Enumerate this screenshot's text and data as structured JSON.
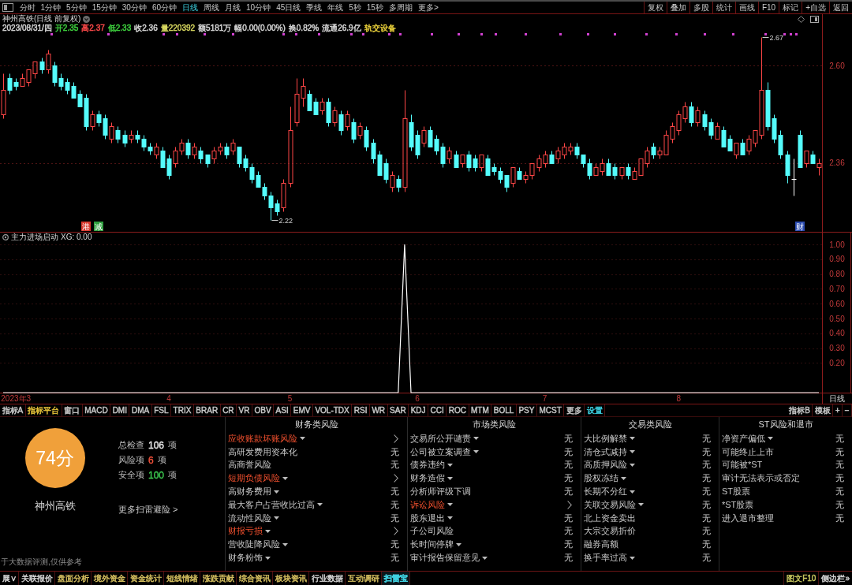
{
  "toolbar": {
    "periods": [
      {
        "label": "分时",
        "selected": false
      },
      {
        "label": "1分钟",
        "selected": false
      },
      {
        "label": "5分钟",
        "selected": false
      },
      {
        "label": "15分钟",
        "selected": false
      },
      {
        "label": "30分钟",
        "selected": false
      },
      {
        "label": "60分钟",
        "selected": false
      },
      {
        "label": "日线",
        "selected": true
      },
      {
        "label": "周线",
        "selected": false
      },
      {
        "label": "月线",
        "selected": false
      },
      {
        "label": "10分钟",
        "selected": false
      },
      {
        "label": "45日线",
        "selected": false
      },
      {
        "label": "季线",
        "selected": false
      },
      {
        "label": "年线",
        "selected": false
      },
      {
        "label": "5秒",
        "selected": false
      },
      {
        "label": "15秒",
        "selected": false
      },
      {
        "label": "多周期",
        "selected": false
      },
      {
        "label": "更多>",
        "selected": false
      }
    ],
    "actions": [
      "复权",
      "叠加",
      "多股",
      "统计",
      "画线",
      "F10",
      "标记",
      "+自选",
      "返回"
    ]
  },
  "stock": {
    "title": "神州高铁(日线 前复权)",
    "quote": [
      {
        "text": "2023/08/31/四",
        "color": "#d8d8d8"
      },
      {
        "text": "开2.35",
        "color": "#3fd43f"
      },
      {
        "text": "高2.37",
        "color": "#ff4a4a"
      },
      {
        "text": "低2.33",
        "color": "#3fd43f"
      },
      {
        "text": "收2.36",
        "color": "#d8d8d8"
      },
      {
        "text": "量220392",
        "color": "#d8d860"
      },
      {
        "text": "额5181万",
        "color": "#d8d8d8"
      },
      {
        "text": "幅0.00(0.00%)",
        "color": "#d8d8d8"
      },
      {
        "text": "换0.82%",
        "color": "#d8d8d8"
      },
      {
        "text": "流通26.9亿",
        "color": "#d8d8d8"
      },
      {
        "text": "轨交设备",
        "color": "#e8cf3a"
      }
    ]
  },
  "price_chart": {
    "event_tags": [
      {
        "label": "港",
        "color": "#d9362b"
      },
      {
        "label": "减",
        "color": "#2e9e3e"
      },
      {
        "label": "财",
        "color": "#2a4bb0"
      }
    ],
    "chart_data": [
      {
        "type": "candlestick",
        "ylim": [
          2.19,
          2.68
        ],
        "yticks": [
          {
            "value": 2.6,
            "label": "2.60"
          },
          {
            "value": 2.36,
            "label": "2.36"
          }
        ],
        "tick_labels": "y",
        "grid": true,
        "annotations": [
          "2.67",
          "2.22"
        ],
        "ohlc": [
          [
            2.48,
            2.58,
            2.47,
            2.54
          ],
          [
            2.57,
            2.58,
            2.53,
            2.54
          ],
          [
            2.56,
            2.57,
            2.54,
            2.55
          ],
          [
            2.55,
            2.58,
            2.55,
            2.57
          ],
          [
            2.56,
            2.59,
            2.55,
            2.59
          ],
          [
            2.58,
            2.61,
            2.57,
            2.61
          ],
          [
            2.61,
            2.62,
            2.58,
            2.59
          ],
          [
            2.59,
            2.64,
            2.58,
            2.63
          ],
          [
            2.6,
            2.61,
            2.55,
            2.56
          ],
          [
            2.57,
            2.58,
            2.54,
            2.55
          ],
          [
            2.56,
            2.57,
            2.53,
            2.54
          ],
          [
            2.55,
            2.56,
            2.52,
            2.52
          ],
          [
            2.53,
            2.54,
            2.5,
            2.5
          ],
          [
            2.52,
            2.53,
            2.44,
            2.45
          ],
          [
            2.45,
            2.49,
            2.44,
            2.48
          ],
          [
            2.48,
            2.49,
            2.45,
            2.46
          ],
          [
            2.47,
            2.48,
            2.42,
            2.43
          ],
          [
            2.42,
            2.46,
            2.41,
            2.45
          ],
          [
            2.44,
            2.45,
            2.41,
            2.42
          ],
          [
            2.43,
            2.44,
            2.4,
            2.41
          ],
          [
            2.42,
            2.44,
            2.41,
            2.43
          ],
          [
            2.43,
            2.44,
            2.41,
            2.42
          ],
          [
            2.42,
            2.43,
            2.39,
            2.4
          ],
          [
            2.4,
            2.41,
            2.38,
            2.39
          ],
          [
            2.38,
            2.41,
            2.37,
            2.4
          ],
          [
            2.39,
            2.4,
            2.35,
            2.35
          ],
          [
            2.37,
            2.38,
            2.32,
            2.33
          ],
          [
            2.36,
            2.4,
            2.35,
            2.39
          ],
          [
            2.39,
            2.42,
            2.38,
            2.41
          ],
          [
            2.41,
            2.42,
            2.37,
            2.38
          ],
          [
            2.38,
            2.41,
            2.37,
            2.4
          ],
          [
            2.39,
            2.4,
            2.36,
            2.37
          ],
          [
            2.38,
            2.38,
            2.35,
            2.36
          ],
          [
            2.37,
            2.4,
            2.36,
            2.39
          ],
          [
            2.39,
            2.41,
            2.38,
            2.4
          ],
          [
            2.4,
            2.41,
            2.37,
            2.38
          ],
          [
            2.39,
            2.42,
            2.38,
            2.41
          ],
          [
            2.4,
            2.4,
            2.35,
            2.36
          ],
          [
            2.37,
            2.38,
            2.34,
            2.35
          ],
          [
            2.35,
            2.36,
            2.31,
            2.32
          ],
          [
            2.33,
            2.34,
            2.3,
            2.3
          ],
          [
            2.3,
            2.31,
            2.27,
            2.28
          ],
          [
            2.28,
            2.29,
            2.22,
            2.25
          ],
          [
            2.26,
            2.27,
            2.23,
            2.24
          ],
          [
            2.25,
            2.32,
            2.24,
            2.31
          ],
          [
            2.31,
            2.5,
            2.3,
            2.44
          ],
          [
            2.46,
            2.57,
            2.45,
            2.53
          ],
          [
            2.52,
            2.57,
            2.5,
            2.55
          ],
          [
            2.53,
            2.54,
            2.49,
            2.49
          ],
          [
            2.51,
            2.52,
            2.48,
            2.48
          ],
          [
            2.49,
            2.52,
            2.48,
            2.51
          ],
          [
            2.51,
            2.52,
            2.45,
            2.46
          ],
          [
            2.46,
            2.5,
            2.45,
            2.49
          ],
          [
            2.48,
            2.49,
            2.43,
            2.44
          ],
          [
            2.45,
            2.49,
            2.44,
            2.48
          ],
          [
            2.46,
            2.47,
            2.41,
            2.42
          ],
          [
            2.43,
            2.46,
            2.42,
            2.45
          ],
          [
            2.44,
            2.45,
            2.39,
            2.4
          ],
          [
            2.41,
            2.42,
            2.36,
            2.37
          ],
          [
            2.38,
            2.39,
            2.33,
            2.33
          ],
          [
            2.36,
            2.37,
            2.31,
            2.32
          ],
          [
            2.3,
            2.34,
            2.29,
            2.33
          ],
          [
            2.32,
            2.33,
            2.29,
            2.3
          ],
          [
            2.3,
            2.54,
            2.29,
            2.47
          ],
          [
            2.46,
            2.48,
            2.39,
            2.4
          ],
          [
            2.43,
            2.44,
            2.37,
            2.38
          ],
          [
            2.41,
            2.45,
            2.4,
            2.44
          ],
          [
            2.44,
            2.45,
            2.4,
            2.4
          ],
          [
            2.42,
            2.43,
            2.38,
            2.39
          ],
          [
            2.4,
            2.41,
            2.35,
            2.36
          ],
          [
            2.37,
            2.4,
            2.36,
            2.39
          ],
          [
            2.38,
            2.39,
            2.35,
            2.35
          ],
          [
            2.36,
            2.38,
            2.35,
            2.38
          ],
          [
            2.38,
            2.39,
            2.34,
            2.35
          ],
          [
            2.37,
            2.38,
            2.34,
            2.35
          ],
          [
            2.35,
            2.38,
            2.34,
            2.38
          ],
          [
            2.37,
            2.38,
            2.33,
            2.33
          ],
          [
            2.35,
            2.36,
            2.33,
            2.34
          ],
          [
            2.34,
            2.35,
            2.31,
            2.32
          ],
          [
            2.33,
            2.33,
            2.29,
            2.3
          ],
          [
            2.31,
            2.35,
            2.3,
            2.35
          ],
          [
            2.34,
            2.35,
            2.32,
            2.32
          ],
          [
            2.32,
            2.34,
            2.31,
            2.33
          ],
          [
            2.33,
            2.36,
            2.32,
            2.36
          ],
          [
            2.35,
            2.38,
            2.34,
            2.37
          ],
          [
            2.36,
            2.39,
            2.35,
            2.38
          ],
          [
            2.38,
            2.39,
            2.36,
            2.36
          ],
          [
            2.37,
            2.4,
            2.36,
            2.39
          ],
          [
            2.38,
            2.41,
            2.37,
            2.4
          ],
          [
            2.39,
            2.41,
            2.38,
            2.4
          ],
          [
            2.4,
            2.41,
            2.37,
            2.38
          ],
          [
            2.38,
            2.38,
            2.35,
            2.36
          ],
          [
            2.36,
            2.37,
            2.32,
            2.33
          ],
          [
            2.33,
            2.36,
            2.33,
            2.35
          ],
          [
            2.34,
            2.37,
            2.33,
            2.36
          ],
          [
            2.36,
            2.37,
            2.33,
            2.33
          ],
          [
            2.35,
            2.36,
            2.32,
            2.33
          ],
          [
            2.33,
            2.35,
            2.32,
            2.35
          ],
          [
            2.35,
            2.36,
            2.32,
            2.33
          ],
          [
            2.32,
            2.35,
            2.32,
            2.34
          ],
          [
            2.33,
            2.37,
            2.33,
            2.37
          ],
          [
            2.36,
            2.4,
            2.35,
            2.39
          ],
          [
            2.4,
            2.41,
            2.37,
            2.38
          ],
          [
            2.38,
            2.4,
            2.37,
            2.39
          ],
          [
            2.38,
            2.44,
            2.38,
            2.43
          ],
          [
            2.42,
            2.46,
            2.41,
            2.45
          ],
          [
            2.44,
            2.49,
            2.43,
            2.48
          ],
          [
            2.47,
            2.51,
            2.46,
            2.5
          ],
          [
            2.5,
            2.51,
            2.45,
            2.46
          ],
          [
            2.46,
            2.5,
            2.45,
            2.49
          ],
          [
            2.48,
            2.49,
            2.44,
            2.45
          ],
          [
            2.46,
            2.47,
            2.42,
            2.43
          ],
          [
            2.42,
            2.46,
            2.42,
            2.45
          ],
          [
            2.44,
            2.45,
            2.4,
            2.4
          ],
          [
            2.42,
            2.43,
            2.39,
            2.39
          ],
          [
            2.38,
            2.41,
            2.37,
            2.41
          ],
          [
            2.41,
            2.42,
            2.38,
            2.38
          ],
          [
            2.39,
            2.43,
            2.38,
            2.42
          ],
          [
            2.41,
            2.44,
            2.4,
            2.44
          ],
          [
            2.43,
            2.67,
            2.42,
            2.54
          ],
          [
            2.54,
            2.56,
            2.44,
            2.45
          ],
          [
            2.47,
            2.48,
            2.41,
            2.42
          ],
          [
            2.43,
            2.44,
            2.37,
            2.38
          ],
          [
            2.38,
            2.39,
            2.31,
            2.33
          ],
          [
            2.32,
            2.37,
            2.28,
            2.32
          ],
          [
            2.43,
            2.44,
            2.35,
            2.35
          ],
          [
            2.36,
            2.39,
            2.35,
            2.39
          ],
          [
            2.38,
            2.39,
            2.36,
            2.36
          ],
          [
            2.35,
            2.37,
            2.33,
            2.36
          ]
        ]
      }
    ]
  },
  "indicator": {
    "reading": "XG: 0.00",
    "period": "日线",
    "chart_data": [
      {
        "type": "line",
        "title": "主力进场启动",
        "color": "#ffffff",
        "grid": true,
        "ylim": [
          0,
          1.08
        ],
        "yticks": [
          {
            "value": 1,
            "label": "1.00"
          },
          {
            "value": 0.9,
            "label": "0.90"
          },
          {
            "value": 0.8,
            "label": "0.80"
          },
          {
            "value": 0.7,
            "label": "0.70"
          },
          {
            "value": 0.6,
            "label": "0.60"
          },
          {
            "value": 0.5,
            "label": "0.50"
          },
          {
            "value": 0.4,
            "label": "0.40"
          },
          {
            "value": 0.3,
            "label": "0.30"
          },
          {
            "value": 0.2,
            "label": "0.20"
          }
        ],
        "categories": [
          null,
          null,
          "2023年3",
          null,
          null,
          null,
          null,
          null,
          null,
          null,
          null,
          null,
          null,
          null,
          null,
          null,
          null,
          null,
          null,
          null,
          null,
          null,
          null,
          null,
          null,
          null,
          "4",
          null,
          null,
          null,
          null,
          null,
          null,
          null,
          null,
          null,
          null,
          null,
          null,
          null,
          null,
          null,
          null,
          null,
          null,
          "5",
          null,
          null,
          null,
          null,
          null,
          null,
          null,
          null,
          null,
          null,
          null,
          null,
          null,
          null,
          null,
          null,
          null,
          null,
          null,
          "6",
          null,
          null,
          null,
          null,
          null,
          null,
          null,
          null,
          null,
          null,
          null,
          null,
          null,
          null,
          null,
          null,
          null,
          null,
          null,
          "7",
          null,
          null,
          null,
          null,
          null,
          null,
          null,
          null,
          null,
          null,
          null,
          null,
          null,
          null,
          null,
          null,
          null,
          null,
          null,
          null,
          "8",
          null,
          null,
          null,
          null,
          null,
          null,
          null,
          null,
          null,
          null,
          null,
          null,
          null,
          null,
          null,
          null,
          null,
          null,
          null,
          null,
          null,
          null
        ],
        "values": [
          0,
          0,
          0,
          0,
          0,
          0,
          0,
          0,
          0,
          0,
          0,
          0,
          0,
          0,
          0,
          0,
          0,
          0,
          0,
          0,
          0,
          0,
          0,
          0,
          0,
          0,
          0,
          0,
          0,
          0,
          0,
          0,
          0,
          0,
          0,
          0,
          0,
          0,
          0,
          0,
          0,
          0,
          0,
          0,
          0,
          0,
          0,
          0,
          0,
          0,
          0,
          0,
          0,
          0,
          0,
          0,
          0,
          0,
          0,
          0,
          0,
          0,
          0,
          1,
          0,
          0,
          0,
          0,
          0,
          0,
          0,
          0,
          0,
          0,
          0,
          0,
          0,
          0,
          0,
          0,
          0,
          0,
          0,
          0,
          0,
          0,
          0,
          0,
          0,
          0,
          0,
          0,
          0,
          0,
          0,
          0,
          0,
          0,
          0,
          0,
          0,
          0,
          0,
          0,
          0,
          0,
          0,
          0,
          0,
          0,
          0,
          0,
          0,
          0,
          0,
          0,
          0,
          0,
          0,
          0,
          0,
          0,
          0,
          0,
          0,
          0,
          0,
          0,
          0
        ]
      }
    ]
  },
  "indicator_tabs": {
    "left": [
      {
        "label": "指标A"
      },
      {
        "label": "指标平台",
        "color": "#e8c53a"
      },
      {
        "label": "窗口"
      },
      {
        "label": "MACD"
      },
      {
        "label": "DMI"
      },
      {
        "label": "DMA"
      },
      {
        "label": "FSL"
      },
      {
        "label": "TRIX"
      },
      {
        "label": "BRAR"
      },
      {
        "label": "CR"
      },
      {
        "label": "VR"
      },
      {
        "label": "OBV"
      },
      {
        "label": "ASI"
      },
      {
        "label": "EMV"
      },
      {
        "label": "VOL-TDX"
      },
      {
        "label": "RSI"
      },
      {
        "label": "WR"
      },
      {
        "label": "SAR"
      },
      {
        "label": "KDJ"
      },
      {
        "label": "CCI"
      },
      {
        "label": "ROC"
      },
      {
        "label": "MTM"
      },
      {
        "label": "BOLL"
      },
      {
        "label": "PSY"
      },
      {
        "label": "MCST"
      },
      {
        "label": "更多"
      },
      {
        "label": "设置",
        "color": "#3cd0e0"
      }
    ],
    "right": [
      {
        "label": "指标B"
      },
      {
        "label": "模板"
      },
      {
        "label": "+"
      },
      {
        "label": "−"
      }
    ]
  },
  "scan": {
    "score": "74分",
    "stock_name": "神州高铁",
    "stats": [
      {
        "label": "总检查",
        "value": "106",
        "unit": "项",
        "color": "#e6e6e6"
      },
      {
        "label": "风险项",
        "value": "6",
        "unit": "项",
        "color": "#f0503a"
      },
      {
        "label": "安全项",
        "value": "100",
        "unit": "项",
        "color": "#3cc850"
      }
    ],
    "more_link": "更多扫雷避险 >",
    "disclaimer": "于大数据评测,仅供参考",
    "columns": [
      {
        "title": "财务类风险",
        "items": [
          {
            "label": "应收账款坏账风险",
            "dropdown": true,
            "risk": true
          },
          {
            "label": "高研发费用资本化",
            "dropdown": false,
            "risk": false,
            "value": "无"
          },
          {
            "label": "高商誉风险",
            "dropdown": false,
            "risk": false,
            "value": "无"
          },
          {
            "label": "短期负债风险",
            "dropdown": true,
            "risk": true
          },
          {
            "label": "高财务费用",
            "dropdown": true,
            "risk": false,
            "value": "无"
          },
          {
            "label": "最大客户占营收比过高",
            "dropdown": true,
            "risk": false,
            "value": "无"
          },
          {
            "label": "流动性风险",
            "dropdown": true,
            "risk": false,
            "value": "无"
          },
          {
            "label": "财报亏损",
            "dropdown": true,
            "risk": true
          },
          {
            "label": "营收陡降风险",
            "dropdown": true,
            "risk": false,
            "value": "无"
          },
          {
            "label": "财务粉饰",
            "dropdown": true,
            "risk": false,
            "value": "无"
          }
        ]
      },
      {
        "title": "市场类风险",
        "items": [
          {
            "label": "交易所公开谴责",
            "dropdown": true,
            "risk": false,
            "value": "无"
          },
          {
            "label": "公司被立案调查",
            "dropdown": true,
            "risk": false,
            "value": "无"
          },
          {
            "label": "债券违约",
            "dropdown": true,
            "risk": false,
            "value": "无"
          },
          {
            "label": "财务造假",
            "dropdown": true,
            "risk": false,
            "value": "无"
          },
          {
            "label": "分析师评级下调",
            "dropdown": false,
            "risk": false,
            "value": "无"
          },
          {
            "label": "诉讼风险",
            "dropdown": true,
            "risk": true
          },
          {
            "label": "股东退出",
            "dropdown": true,
            "risk": false,
            "value": "无"
          },
          {
            "label": "子公司风险",
            "dropdown": false,
            "risk": false,
            "value": "无"
          },
          {
            "label": "长时间停牌",
            "dropdown": true,
            "risk": false,
            "value": "无"
          },
          {
            "label": "审计报告保留意见",
            "dropdown": true,
            "risk": false,
            "value": "无"
          }
        ]
      },
      {
        "title": "交易类风险",
        "items": [
          {
            "label": "大比例解禁",
            "dropdown": true,
            "risk": false,
            "value": "无"
          },
          {
            "label": "清仓式减持",
            "dropdown": true,
            "risk": false,
            "value": "无"
          },
          {
            "label": "高质押风险",
            "dropdown": true,
            "risk": false,
            "value": "无"
          },
          {
            "label": "股权冻结",
            "dropdown": true,
            "risk": false,
            "value": "无"
          },
          {
            "label": "长期不分红",
            "dropdown": true,
            "risk": false,
            "value": "无"
          },
          {
            "label": "关联交易风险",
            "dropdown": true,
            "risk": false,
            "value": "无"
          },
          {
            "label": "北上资金卖出",
            "dropdown": false,
            "risk": false,
            "value": "无"
          },
          {
            "label": "大宗交易折价",
            "dropdown": false,
            "risk": false,
            "value": "无"
          },
          {
            "label": "融券高额",
            "dropdown": false,
            "risk": false,
            "value": "无"
          },
          {
            "label": "换手率过高",
            "dropdown": true,
            "risk": false,
            "value": "无"
          }
        ]
      },
      {
        "title": "ST风险和退市",
        "items": [
          {
            "label": "净资产偏低",
            "dropdown": true,
            "risk": false,
            "value": "无"
          },
          {
            "label": "可能终止上市",
            "dropdown": false,
            "risk": false,
            "value": "无"
          },
          {
            "label": "可能被*ST",
            "dropdown": false,
            "risk": false,
            "value": "无"
          },
          {
            "label": "审计无法表示或否定",
            "dropdown": false,
            "risk": false,
            "value": "无"
          },
          {
            "label": "ST股票",
            "dropdown": false,
            "risk": false,
            "value": "无"
          },
          {
            "label": "*ST股票",
            "dropdown": false,
            "risk": false,
            "value": "无"
          },
          {
            "label": "进入退市整理",
            "dropdown": false,
            "risk": false,
            "value": "无"
          }
        ]
      }
    ]
  },
  "bottom_tabs": {
    "left": [
      {
        "label": "展∨",
        "selected": false,
        "color": "#d8d8d8"
      },
      {
        "label": "关联报价",
        "selected": false,
        "color": "#d8d8d8"
      },
      {
        "label": "盘面分析",
        "selected": false,
        "color": "#d6c060"
      },
      {
        "label": "境外资金",
        "selected": false,
        "color": "#d6c060"
      },
      {
        "label": "资金统计",
        "selected": false,
        "color": "#d6c060"
      },
      {
        "label": "短线情绪",
        "selected": false,
        "color": "#d6c060"
      },
      {
        "label": "涨跌贡献",
        "selected": false,
        "color": "#d6c060"
      },
      {
        "label": "综合资讯",
        "selected": false,
        "color": "#d6c060"
      },
      {
        "label": "板块资讯",
        "selected": false,
        "color": "#d6c060"
      },
      {
        "label": "行业数据",
        "selected": false,
        "color": "#d8d8d8"
      },
      {
        "label": "互动调研",
        "selected": false,
        "color": "#d6c060"
      },
      {
        "label": "扫雷宝",
        "selected": true,
        "color": "#3fd0e0"
      }
    ],
    "right": [
      {
        "label": "图文F10",
        "color": "#c8c860"
      },
      {
        "label": "侧边栏»",
        "color": "#d8d8d8"
      }
    ]
  }
}
